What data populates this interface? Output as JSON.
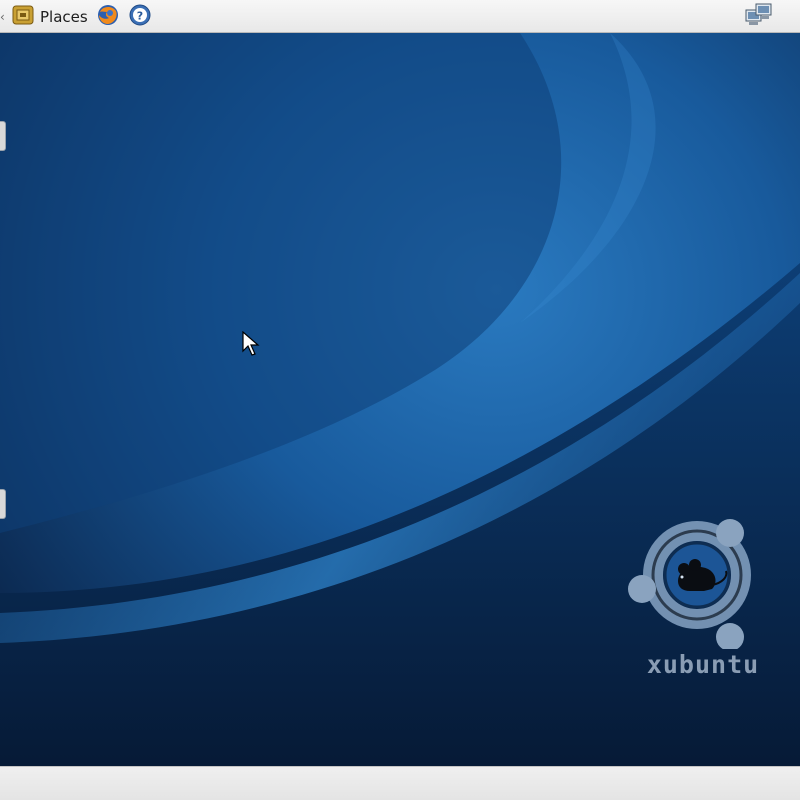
{
  "top_panel": {
    "left_arrow": "‹",
    "places_label": "Places",
    "icons": [
      "places-menu-icon",
      "firefox-icon",
      "help-icon",
      "network-icon"
    ]
  },
  "desktop": {
    "brand_wordmark": "xubuntu",
    "colors": {
      "wallpaper_dark": "#0b2a55",
      "wallpaper_light": "#2a7ac0",
      "panel": "#efefef"
    }
  }
}
